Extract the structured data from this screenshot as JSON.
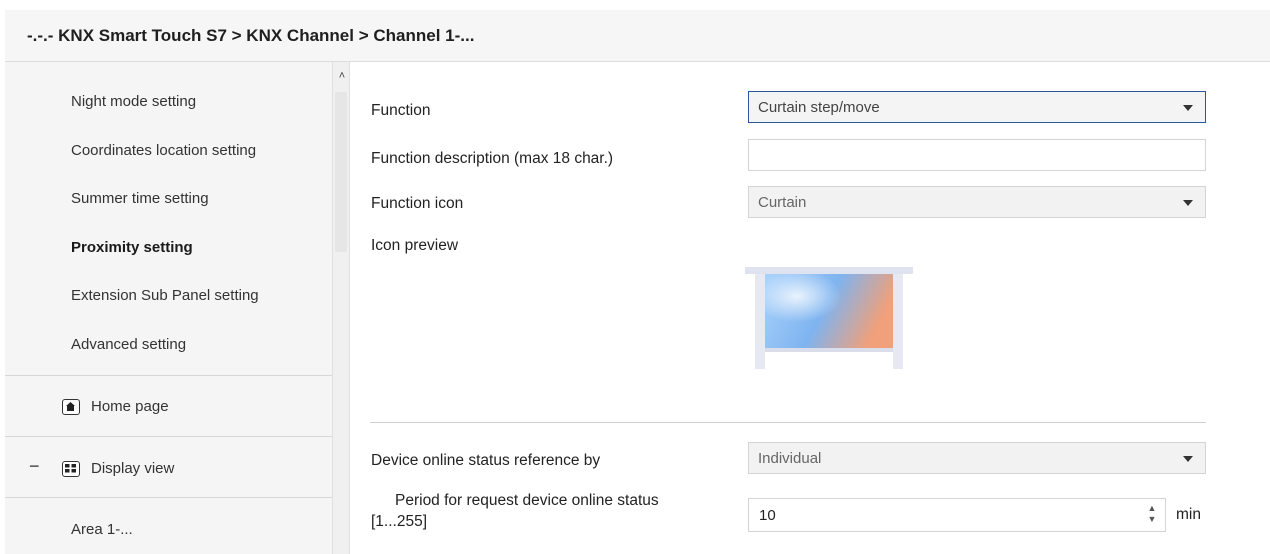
{
  "breadcrumb": "-.-.- KNX Smart Touch S7 > KNX Channel  > Channel 1-...",
  "sidebar": {
    "items": [
      {
        "label": "Night mode setting"
      },
      {
        "label": "Coordinates location setting"
      },
      {
        "label": "Summer time setting"
      },
      {
        "label": "Proximity setting"
      },
      {
        "label": "Extension Sub Panel setting"
      },
      {
        "label": "Advanced setting"
      },
      {
        "label": "Home page"
      },
      {
        "label": "Display view",
        "expander": "−"
      },
      {
        "label": "Area 1-..."
      }
    ],
    "selected_item": "Proximity setting"
  },
  "form": {
    "function": {
      "label": "Function",
      "value": "Curtain step/move"
    },
    "function_description": {
      "label": "Function description (max 18 char.)",
      "value": ""
    },
    "function_icon": {
      "label": "Function icon",
      "value": "Curtain"
    },
    "icon_preview": {
      "label": "Icon preview",
      "icon": "curtain-window-icon"
    },
    "online_status_reference": {
      "label": "Device online status reference by",
      "value": "Individual"
    },
    "request_period": {
      "label_line1": "Period for request device online status",
      "label_line2": "[1...255]",
      "value": "10",
      "unit": "min"
    }
  },
  "colors": {
    "active_border": "#2b5797",
    "sidebar_bg": "#f5f5f5",
    "preview_sky": "#7fb4f0",
    "preview_glow": "#f0a07a"
  }
}
